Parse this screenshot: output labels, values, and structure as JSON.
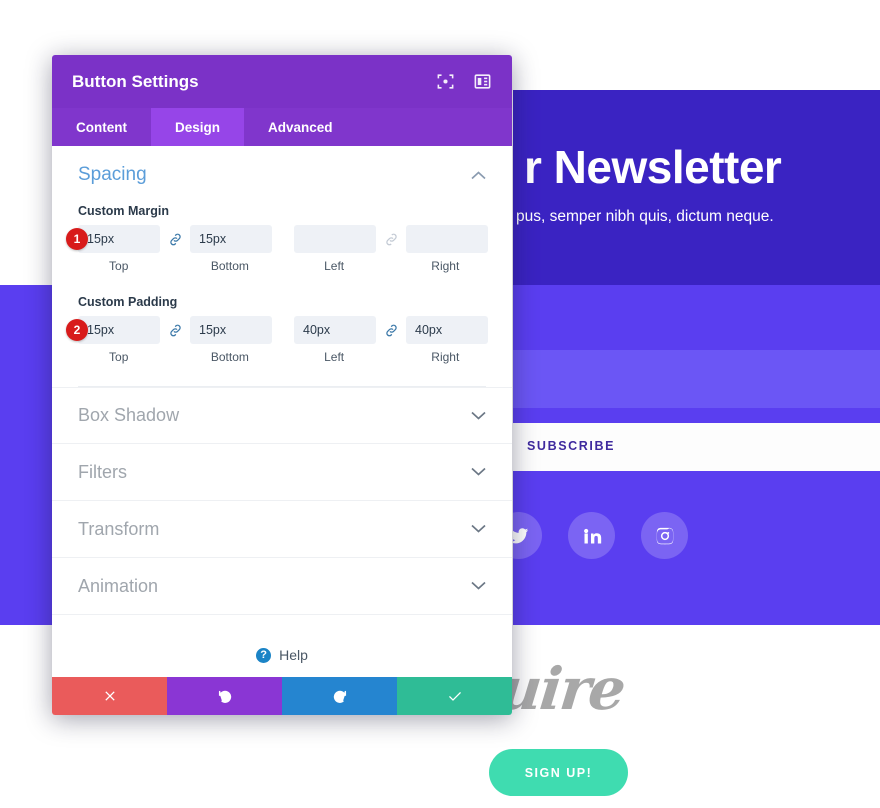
{
  "background": {
    "hero_title": "r Newsletter",
    "hero_subtitle": "pus, semper nibh quis, dictum neque.",
    "subscribe_label": "SUBSCRIBE",
    "script_logo": "uire",
    "signup_label": "SIGN UP!",
    "social": [
      {
        "name": "twitter",
        "label": "Twitter"
      },
      {
        "name": "linkedin",
        "label": "LinkedIn"
      },
      {
        "name": "instagram",
        "label": "Instagram"
      }
    ],
    "colors": {
      "hero": "#3a23c2",
      "band_mid": "#5a3ef0",
      "band_light": "#6b56f5",
      "subscribe_text": "#3f2a9e",
      "signup_btn": "#3fdcb0",
      "script_logo": "#a8a8a8"
    }
  },
  "modal": {
    "title": "Button Settings",
    "header_icons": [
      {
        "name": "focus-target-icon"
      },
      {
        "name": "layout-panel-icon"
      }
    ],
    "tabs": [
      {
        "label": "Content",
        "active": false
      },
      {
        "label": "Design",
        "active": true
      },
      {
        "label": "Advanced",
        "active": false
      }
    ],
    "spacing": {
      "title": "Spacing",
      "expanded": true,
      "margin": {
        "label": "Custom Margin",
        "badge": "1",
        "top": {
          "value": "15px",
          "label": "Top"
        },
        "bottom": {
          "value": "15px",
          "label": "Bottom"
        },
        "left": {
          "value": "",
          "placeholder": "",
          "label": "Left"
        },
        "right": {
          "value": "",
          "placeholder": "",
          "label": "Right"
        },
        "link_tb": "linked",
        "link_lr": "unlinked"
      },
      "padding": {
        "label": "Custom Padding",
        "badge": "2",
        "top": {
          "value": "15px",
          "label": "Top"
        },
        "bottom": {
          "value": "15px",
          "label": "Bottom"
        },
        "left": {
          "value": "40px",
          "label": "Left"
        },
        "right": {
          "value": "40px",
          "label": "Right"
        },
        "link_tb": "linked",
        "link_lr": "linked"
      }
    },
    "collapsed_sections": [
      {
        "label": "Box Shadow"
      },
      {
        "label": "Filters"
      },
      {
        "label": "Transform"
      },
      {
        "label": "Animation"
      }
    ],
    "help": {
      "label": "Help",
      "icon_char": "?"
    },
    "footer_buttons": [
      {
        "name": "cancel",
        "icon": "x",
        "color": "#ea5b5b"
      },
      {
        "name": "undo",
        "icon": "undo",
        "color": "#8a36d4"
      },
      {
        "name": "redo",
        "icon": "redo",
        "color": "#2585d0"
      },
      {
        "name": "save",
        "icon": "check",
        "color": "#2fbc96"
      }
    ],
    "colors": {
      "header": "#7b32c7",
      "tabbar": "#8036cc",
      "tab_active": "#9645e8",
      "section_title": "#5b9dd9",
      "badge": "#d81b1b",
      "input_bg": "#eef1f6"
    }
  }
}
